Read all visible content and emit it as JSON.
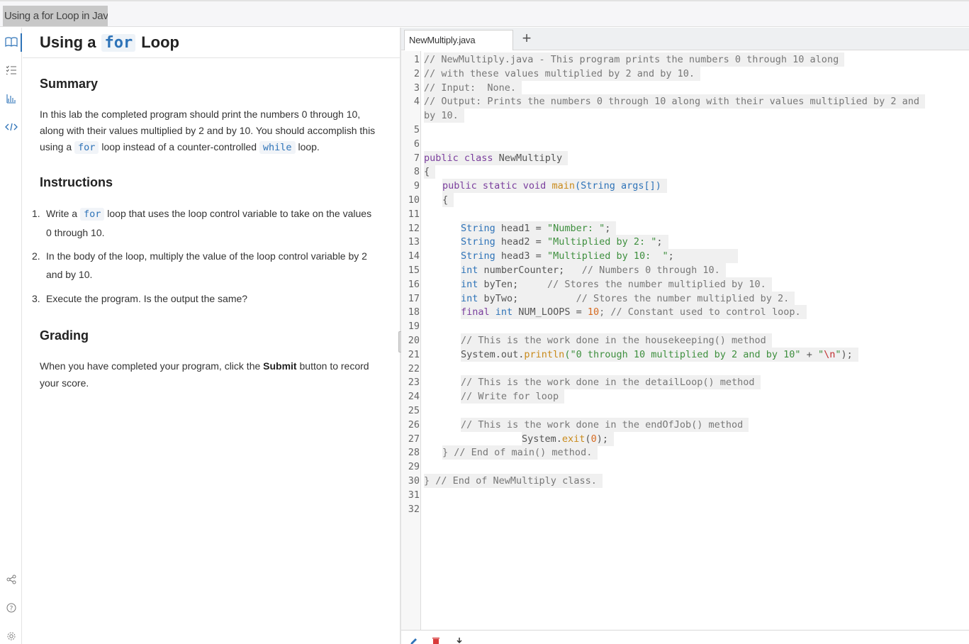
{
  "window": {
    "title": "Using a for Loop in Java"
  },
  "rail": {
    "icons": [
      "book-icon",
      "checklist-icon",
      "chart-icon",
      "code-icon",
      "share-icon",
      "help-icon",
      "settings-icon"
    ]
  },
  "instructions": {
    "title_pre": "Using a",
    "title_code": "for",
    "title_post": "Loop",
    "summary_heading": "Summary",
    "summary_text_1": "In this lab the completed program should print the numbers 0 through 10, along with their values multiplied by 2 and by 10. You should accomplish this using a",
    "summary_code_1": "for",
    "summary_text_2": "loop instead of a counter-controlled",
    "summary_code_2": "while",
    "summary_text_3": "loop.",
    "instructions_heading": "Instructions",
    "steps": [
      {
        "num": "1.",
        "pre": "Write a",
        "code": "for",
        "post": "loop that uses the loop control variable to take on the values 0 through 10."
      },
      {
        "num": "2.",
        "text": "In the body of the loop, multiply the value of the loop control variable by 2 and by 10."
      },
      {
        "num": "3.",
        "text": "Execute the program. Is the output the same?"
      }
    ],
    "grading_heading": "Grading",
    "grading_pre": "When you have completed your program, click the",
    "grading_bold": "Submit",
    "grading_post": "button to record your score."
  },
  "editor": {
    "tab_label": "NewMultiply.java",
    "add_tab_label": "+",
    "line_numbers": [
      "1",
      "2",
      "3",
      "4",
      "",
      "5",
      "6",
      "7",
      "8",
      "9",
      "10",
      "11",
      "12",
      "13",
      "14",
      "15",
      "16",
      "17",
      "18",
      "19",
      "20",
      "21",
      "22",
      "23",
      "24",
      "25",
      "26",
      "27",
      "28",
      "29",
      "30",
      "31",
      "32"
    ],
    "lines": {
      "l1": "// NewMultiply.java - This program prints the numbers 0 through 10 along",
      "l2": "// with these values multiplied by 2 and by 10.",
      "l3": "// Input:  None.",
      "l4a": "// Output: Prints the numbers 0 through 10 along with their values multiplied by 2 and",
      "l4b": "by 10.",
      "l7_kw": "public class",
      "l7_rest": " NewMultiply",
      "l8": "{",
      "l9_kw": "public static void",
      "l9_fn": "main",
      "l9_ty": "(String args[])",
      "l10": "{",
      "l12_ty": "String",
      "l12_rest": " head1 = ",
      "l12_st": "\"Number: \"",
      "l12_end": ";",
      "l13_ty": "String",
      "l13_rest": " head2 = ",
      "l13_st": "\"Multiplied by 2: \"",
      "l13_end": ";",
      "l14_ty": "String",
      "l14_rest": " head3 = ",
      "l14_st": "\"Multiplied by 10:  \"",
      "l14_end": ";",
      "l15_ty": "int",
      "l15_rest": " numberCounter;   ",
      "l15_cm": "// Numbers 0 through 10.",
      "l16_ty": "int",
      "l16_rest": " byTen;     ",
      "l16_cm": "// Stores the number multiplied by 10.",
      "l17_ty": "int",
      "l17_rest": " byTwo;          ",
      "l17_cm": "// Stores the number multiplied by 2.",
      "l18_kw": "final",
      "l18_ty": "int",
      "l18_rest": " NUM_LOOPS = ",
      "l18_nu": "10",
      "l18_cm": "; // Constant used to control loop.",
      "l20": "// This is the work done in the housekeeping() method",
      "l21_pre": "System.out.",
      "l21_fn": "println",
      "l21_st": "(\"0 through 10 multiplied by 2 and by 10\"",
      "l21_plus": " + ",
      "l21_q1": "\"",
      "l21_es": "\\n",
      "l21_q2": "\"",
      "l21_end": ");",
      "l23": "// This is the work done in the detailLoop() method",
      "l24": "// Write for loop",
      "l26": "// This is the work done in the endOfJob() method",
      "l27_pre": "System.",
      "l27_fn": "exit",
      "l27_open": "(",
      "l27_nu": "0",
      "l27_end": ");",
      "l28": "} // End of main() method.",
      "l30": "} // End of NewMultiply class."
    }
  },
  "toolbar": {
    "icons": [
      "edit-icon",
      "delete-icon",
      "download-icon"
    ]
  },
  "colors": {
    "accent": "#2e73b8",
    "keyword": "#7a3e9d",
    "string": "#3e8f3e",
    "number": "#d66a20",
    "function": "#c98a1a"
  }
}
